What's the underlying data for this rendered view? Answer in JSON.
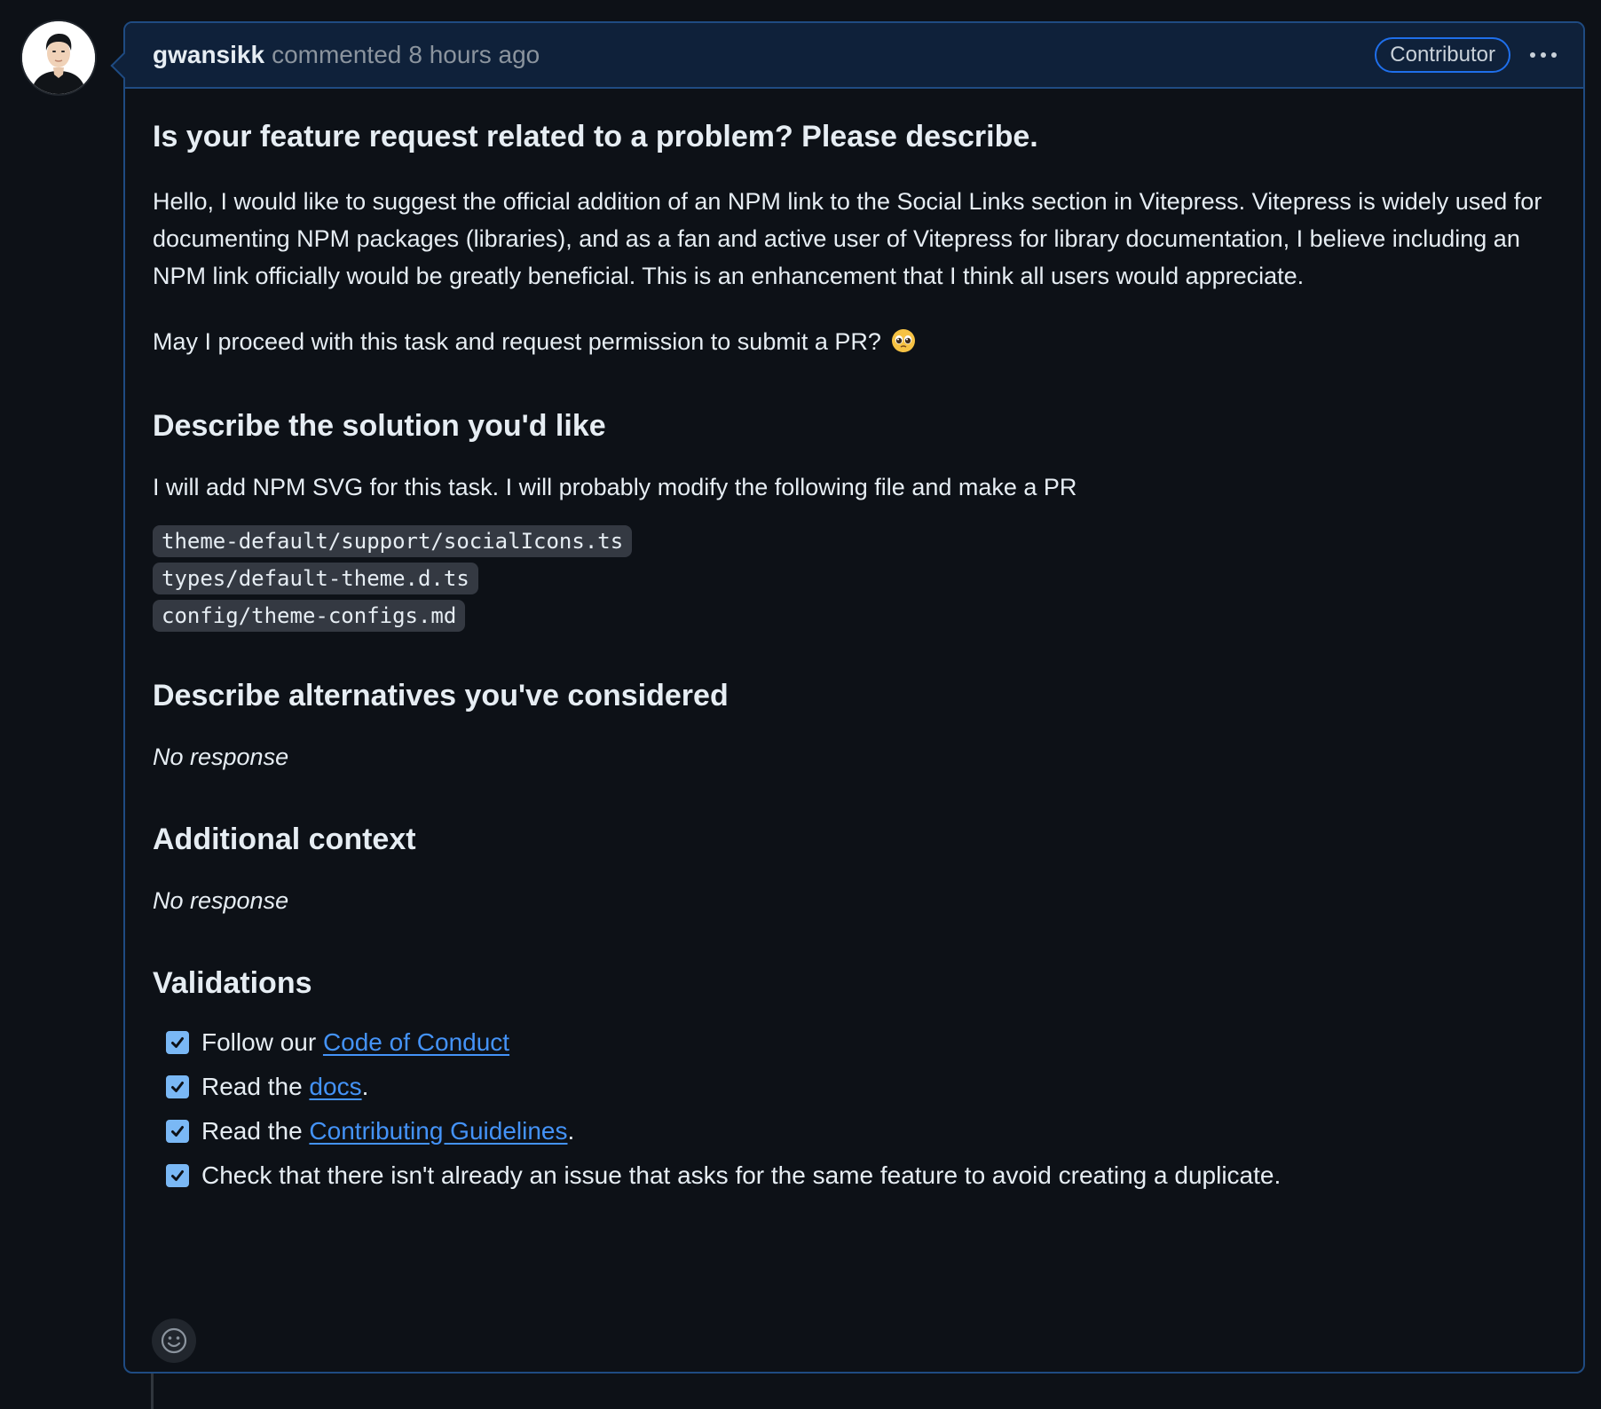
{
  "comment": {
    "author": "gwansikk",
    "action": "commented",
    "time": "8 hours ago",
    "badge": "Contributor"
  },
  "body": {
    "problem_heading": "Is your feature request related to a problem? Please describe.",
    "problem_text": "Hello, I would like to suggest the official addition of an NPM link to the Social Links section in Vitepress. Vitepress is widely used for documenting NPM packages (libraries), and as a fan and active user of Vitepress for library documentation, I believe including an NPM link officially would be greatly beneficial. This is an enhancement that I think all users would appreciate.",
    "problem_question": "May I proceed with this task and request permission to submit a PR?",
    "solution_heading": "Describe the solution you'd like",
    "solution_text": "I will add NPM SVG for this task. I will probably modify the following file and make a PR",
    "files": [
      "theme-default/support/socialIcons.ts",
      "types/default-theme.d.ts",
      "config/theme-configs.md"
    ],
    "alternatives_heading": "Describe alternatives you've considered",
    "alternatives_text": "No response",
    "context_heading": "Additional context",
    "context_text": "No response",
    "validations_heading": "Validations",
    "validations": [
      {
        "prefix": "Follow our ",
        "link": "Code of Conduct",
        "suffix": "",
        "checked": true
      },
      {
        "prefix": "Read the ",
        "link": "docs",
        "suffix": ".",
        "checked": true
      },
      {
        "prefix": "Read the ",
        "link": "Contributing Guidelines",
        "suffix": ".",
        "checked": true
      },
      {
        "prefix": "Check that there isn't already an issue that asks for the same feature to avoid creating a duplicate.",
        "link": "",
        "suffix": "",
        "checked": true
      }
    ]
  },
  "icons": {
    "more": "kebab-horizontal-icon",
    "reaction": "smiley-icon",
    "emoji": "pleading-face-emoji",
    "check": "checkmark-icon"
  },
  "colors": {
    "background": "#0d1117",
    "header_bg": "#0f213a",
    "border": "#1f4b82",
    "link": "#4493f8",
    "checkbox": "#7ab8f5"
  }
}
